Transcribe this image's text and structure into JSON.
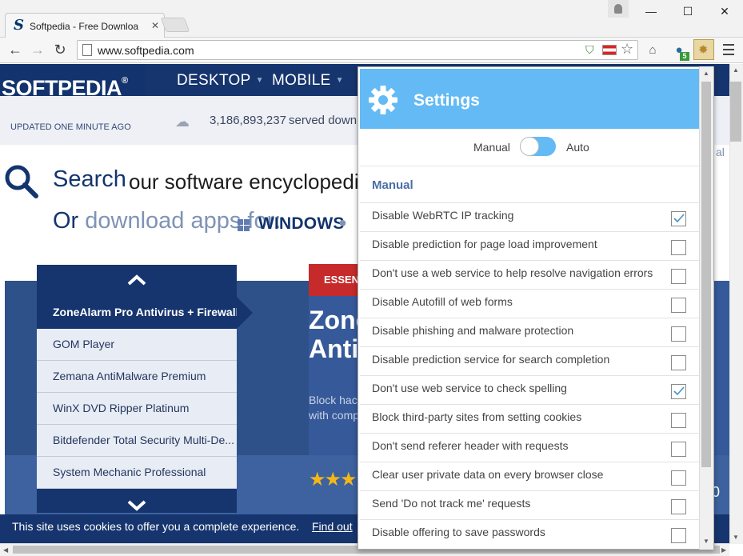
{
  "browser": {
    "tab_title": "Softpedia - Free Downloa",
    "tab_close": "✕",
    "url": "www.softpedia.com",
    "window_controls": {
      "minimize": "—",
      "maximize": "☐",
      "close": "✕"
    },
    "extension_badge": "5",
    "icons": [
      "back-icon",
      "forward-icon",
      "reload-icon",
      "shield-icon",
      "flag-icon",
      "star-icon",
      "menu-icon"
    ]
  },
  "site": {
    "logo": "SOFTPEDIA",
    "logo_mark": "®",
    "nav": [
      "DESKTOP",
      "MOBILE"
    ],
    "updated": "UPDATED ONE MINUTE AGO",
    "served_count": "3,186,893,237",
    "served_text": "served downlo",
    "search_label": "Search",
    "search_text": "our software encyclopedia",
    "or_word": "Or",
    "download_for": " download apps for:",
    "windows": "WINDOWS",
    "right_edge": "al",
    "essentials": "ESSENT",
    "hero_title_1": "Zone",
    "hero_title_2": "Anti",
    "hero_desc_1": "Block hac",
    "hero_desc_2": "with comp",
    "hero_stars": "★★★",
    "right_strip": "0",
    "carousel": [
      "ZoneAlarm Pro Antivirus + Firewall",
      "GOM Player",
      "Zemana AntiMalware Premium",
      "WinX DVD Ripper Platinum",
      "Bitdefender Total Security Multi-De...",
      "System Mechanic Professional"
    ],
    "cookie_text": "This site uses cookies to offer you a complete experience.",
    "cookie_link": "Find out"
  },
  "popup": {
    "title": "Settings",
    "mode_left": "Manual",
    "mode_right": "Auto",
    "mode_value": "Manual",
    "section": "Manual",
    "accent": "#63baf5",
    "settings": [
      {
        "label": "Disable WebRTC IP tracking",
        "checked": true
      },
      {
        "label": "Disable prediction for page load improvement",
        "checked": false
      },
      {
        "label": "Don't use a web service to help resolve navigation errors",
        "checked": false
      },
      {
        "label": "Disable Autofill of web forms",
        "checked": false
      },
      {
        "label": "Disable phishing and malware protection",
        "checked": false
      },
      {
        "label": "Disable prediction service for search completion",
        "checked": false
      },
      {
        "label": "Don't use web service to check spelling",
        "checked": true
      },
      {
        "label": "Block third-party sites from setting cookies",
        "checked": false
      },
      {
        "label": "Don't send referer header with requests",
        "checked": false
      },
      {
        "label": "Clear user private data on every browser close",
        "checked": false
      },
      {
        "label": "Send 'Do not track me' requests",
        "checked": false
      },
      {
        "label": "Disable offering to save passwords",
        "checked": false
      }
    ]
  }
}
